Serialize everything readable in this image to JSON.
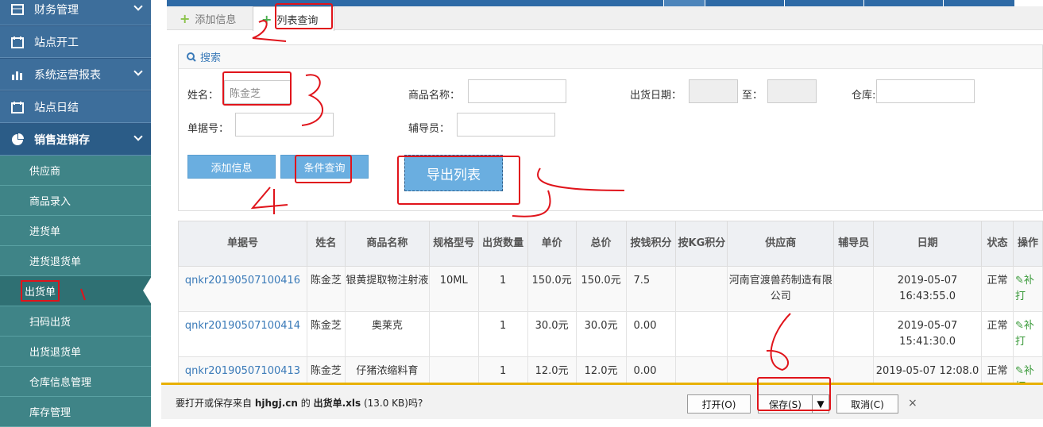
{
  "sidebar": {
    "items": [
      {
        "label": "财务管理",
        "icon": "table-icon",
        "chevron": true
      },
      {
        "label": "站点开工",
        "icon": "calendar-icon",
        "chevron": false
      },
      {
        "label": "系统运营报表",
        "icon": "bar-chart-icon",
        "chevron": true
      },
      {
        "label": "站点日结",
        "icon": "calendar-icon",
        "chevron": false
      },
      {
        "label": "销售进销存",
        "icon": "pie-chart-icon",
        "chevron": true
      }
    ],
    "sub_items": [
      {
        "label": "供应商"
      },
      {
        "label": "商品录入"
      },
      {
        "label": "进货单"
      },
      {
        "label": "进货退货单"
      },
      {
        "label": "出货单"
      },
      {
        "label": "扫码出货"
      },
      {
        "label": "出货退货单"
      },
      {
        "label": "仓库信息管理"
      },
      {
        "label": "库存管理"
      }
    ]
  },
  "tabs": [
    {
      "label": "添加信息"
    },
    {
      "label": "列表查询"
    }
  ],
  "search": {
    "title": "搜索",
    "name_label": "姓名：",
    "name_value": "陈金芝",
    "product_label": "商品名称：",
    "date_label": "出货日期：",
    "date_to": "至：",
    "warehouse_label": "仓库:",
    "doc_label": "单据号：",
    "counselor_label": "辅导员："
  },
  "buttons": {
    "add": "添加信息",
    "query": "条件查询",
    "export": "导出列表"
  },
  "table": {
    "headers": [
      "单据号",
      "姓名",
      "商品名称",
      "规格型号",
      "出货数量",
      "单价",
      "总价",
      "按钱积分",
      "按KG积分",
      "供应商",
      "辅导员",
      "日期",
      "状态",
      "操作"
    ],
    "rows": [
      {
        "id": "qnkr20190507100416",
        "name": "陈金芝",
        "product": "银黄提取物注射液",
        "spec": "10ML",
        "qty": "1",
        "price": "150.0元",
        "total": "150.0元",
        "money_pts": "7.5",
        "kg_pts": "",
        "supplier": "河南官渡兽药制造有限公司",
        "counselor": "",
        "date": "2019-05-07 16:43:55.0",
        "status": "正常",
        "op": "补打"
      },
      {
        "id": "qnkr20190507100414",
        "name": "陈金芝",
        "product": "奥莱克",
        "spec": "",
        "qty": "1",
        "price": "30.0元",
        "total": "30.0元",
        "money_pts": "0.00",
        "kg_pts": "",
        "supplier": "",
        "counselor": "",
        "date": "2019-05-07 15:41:30.0",
        "status": "正常",
        "op": "补打"
      },
      {
        "id": "qnkr20190507100413",
        "name": "陈金芝",
        "product": "仔猪浓缩料育",
        "spec": "",
        "qty": "1",
        "price": "12.0元",
        "total": "12.0元",
        "money_pts": "0.00",
        "kg_pts": "",
        "supplier": "",
        "counselor": "",
        "date": "2019-05-07 12:08.0",
        "status": "正常",
        "op": "补打"
      }
    ]
  },
  "download_bar": {
    "message_prefix": "要打开或保存来自 ",
    "site": "hjhgj.cn",
    "message_mid": " 的 ",
    "file": "出货单.xls",
    "message_suffix": " (13.0 KB)吗?",
    "open": "打开(O)",
    "save": "保存(S)",
    "cancel": "取消(C)",
    "close": "×"
  },
  "colors": {
    "sidebar_blue": "#3d6e9b",
    "sidebar_teal": "#3f8487",
    "accent": "#6aaee0",
    "annotation_red": "#e0141b"
  }
}
